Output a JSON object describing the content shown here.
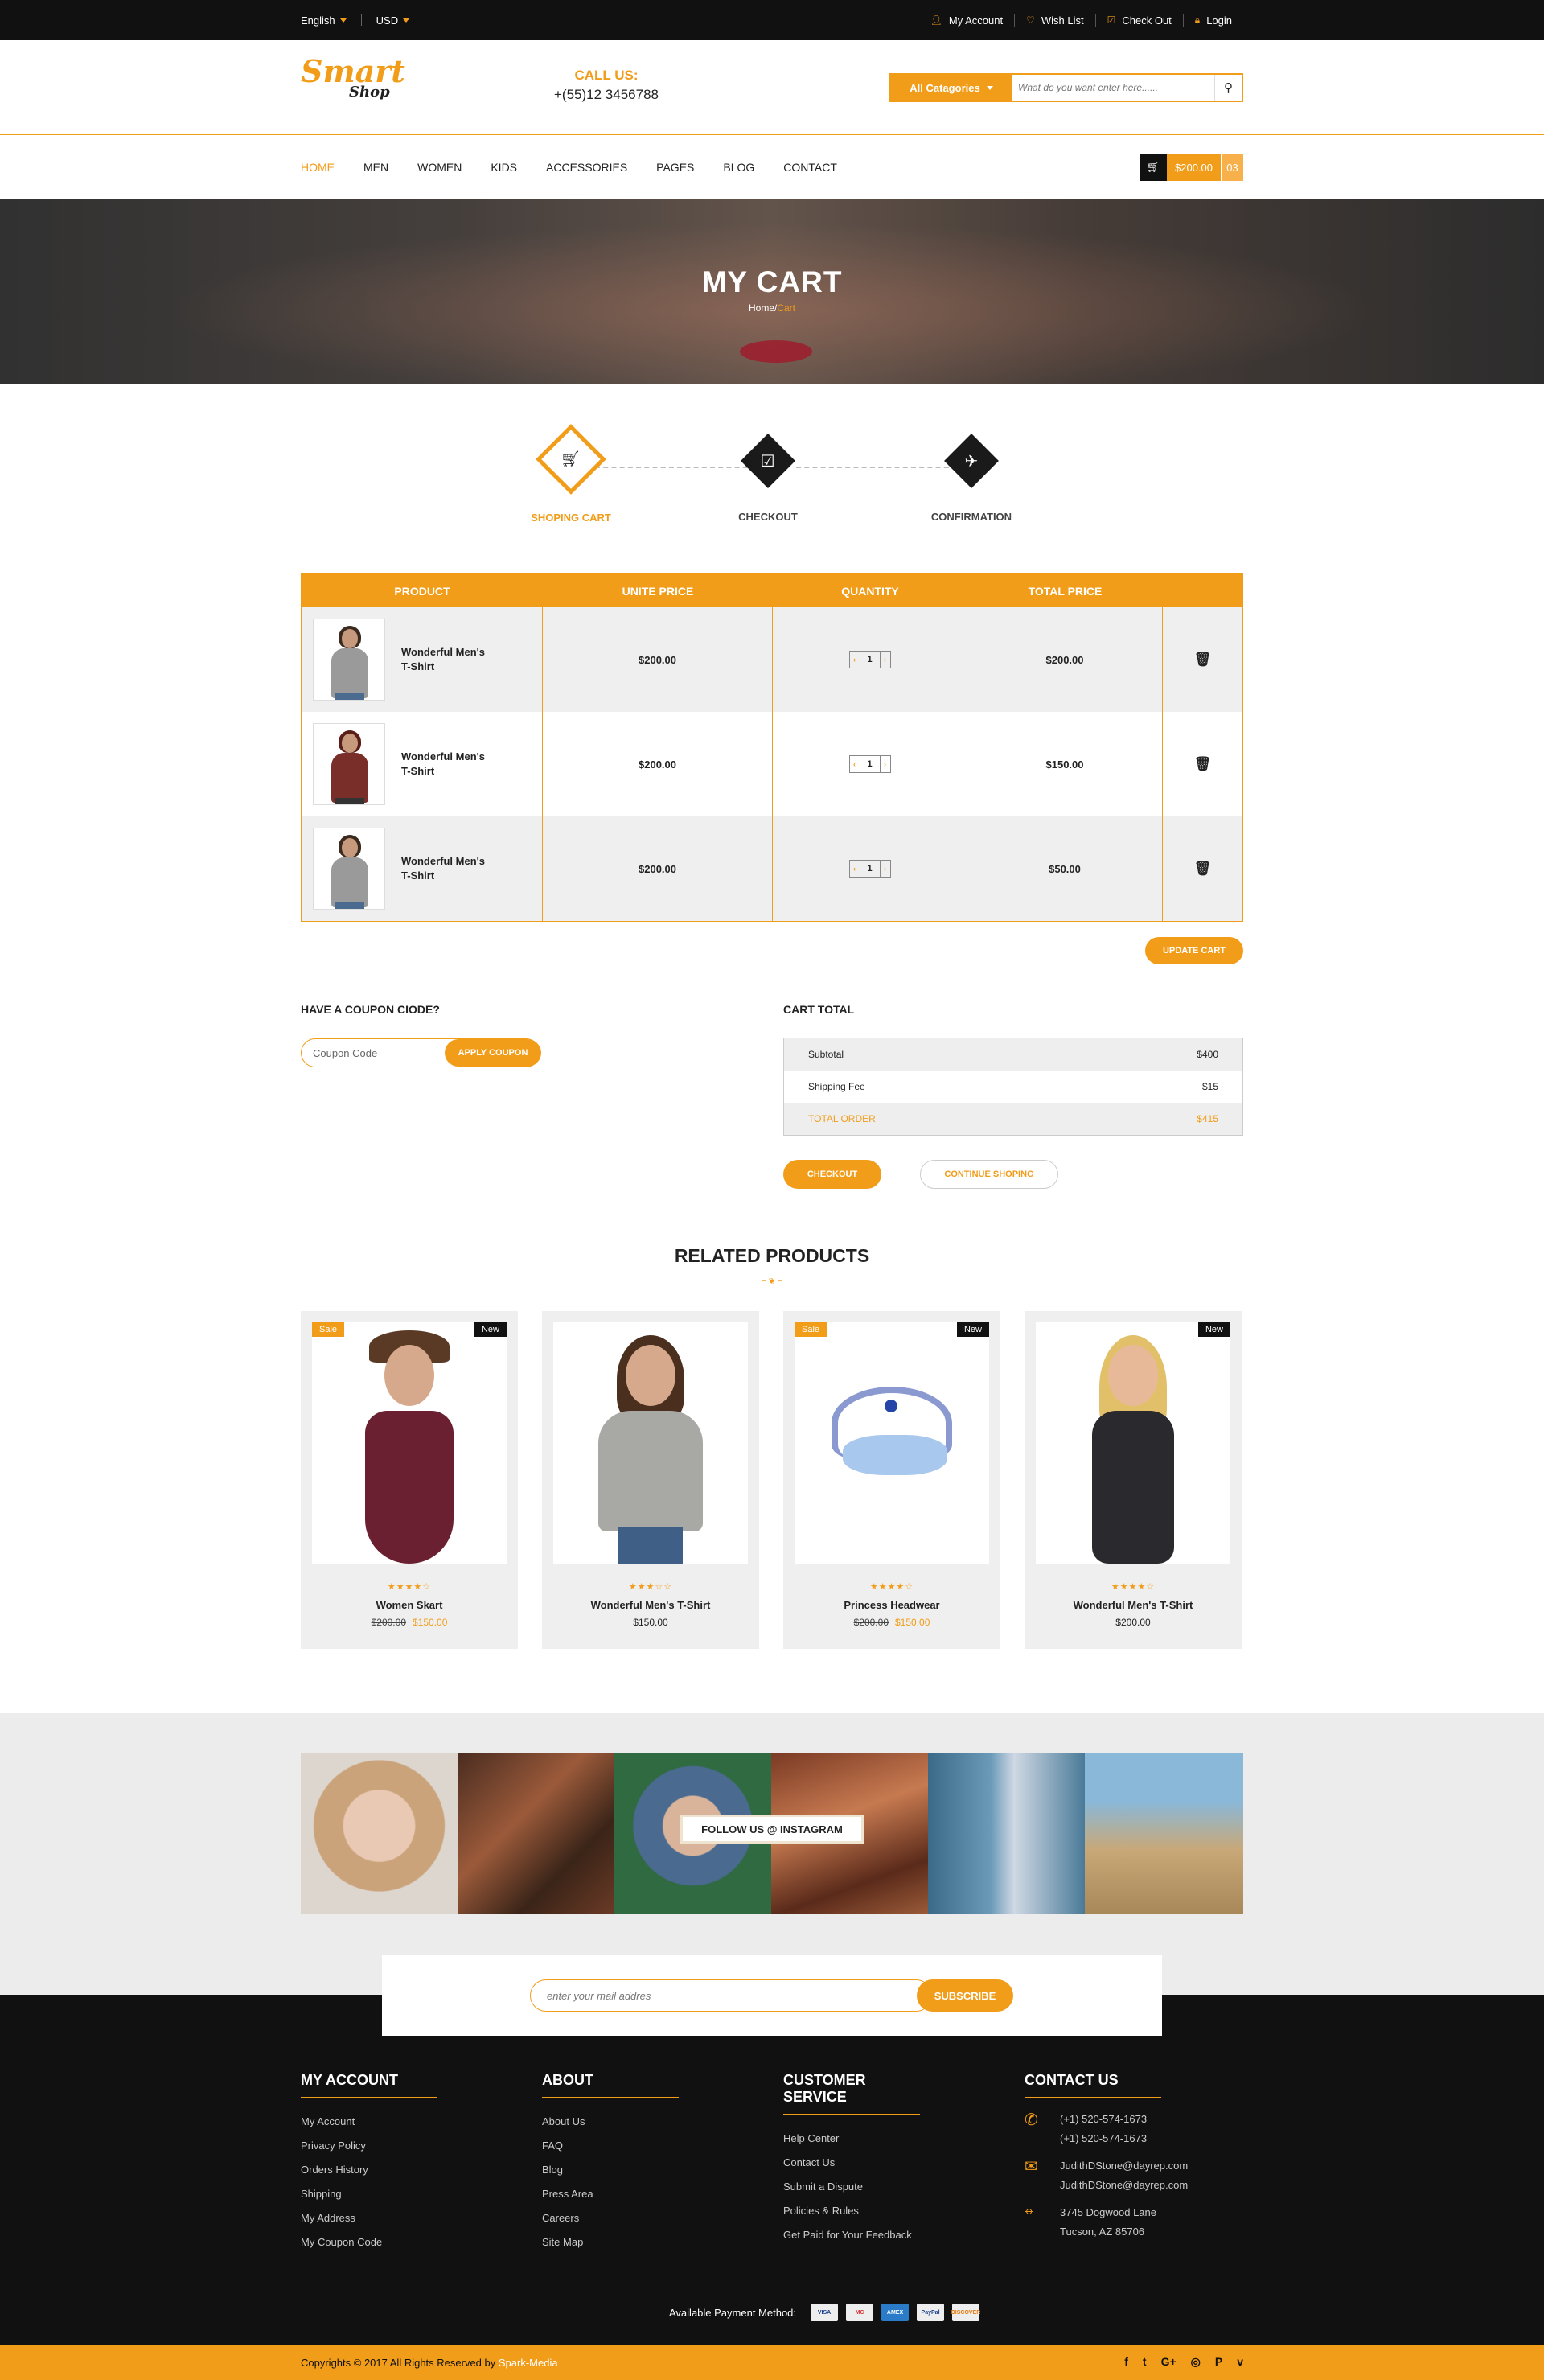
{
  "topbar": {
    "language": "English",
    "currency": "USD",
    "links": [
      {
        "icon": "user-icon",
        "label": "My Account"
      },
      {
        "icon": "heart-icon",
        "label": "Wish List"
      },
      {
        "icon": "checkbox-icon",
        "label": "Check Out"
      },
      {
        "icon": "lock-icon",
        "label": "Login"
      }
    ]
  },
  "header": {
    "logo_main": "Smart",
    "logo_sub": "Shop",
    "call_label": "CALL US:",
    "phone": "+(55)12 3456788",
    "search": {
      "category": "All Catagories",
      "placeholder": "What do you want enter here......"
    }
  },
  "nav": {
    "items": [
      "HOME",
      "MEN",
      "WOMEN",
      "KIDS",
      "ACCESSORIES",
      "PAGES",
      "BLOG",
      "CONTACT"
    ],
    "active": "HOME",
    "cart_total": "$200.00",
    "cart_count": "03"
  },
  "banner": {
    "title": "MY CART",
    "crumb_home": "Home/",
    "crumb_current": "Cart"
  },
  "steps": [
    {
      "label": "SHOPING CART",
      "icon": "cart-icon",
      "active": true
    },
    {
      "label": "CHECKOUT",
      "icon": "check-square-icon",
      "active": false
    },
    {
      "label": "CONFIRMATION",
      "icon": "paper-plane-icon",
      "active": false
    }
  ],
  "cart": {
    "headers": [
      "PRODUCT",
      "UNITE PRICE",
      "QUANTITY",
      "TOTAL PRICE"
    ],
    "rows": [
      {
        "name_line1": "Wonderful Men's",
        "name_line2": "T-Shirt",
        "unit_price": "$200.00",
        "qty": "1",
        "total": "$200.00"
      },
      {
        "name_line1": "Wonderful Men's",
        "name_line2": "T-Shirt",
        "unit_price": "$200.00",
        "qty": "1",
        "total": "$150.00"
      },
      {
        "name_line1": "Wonderful Men's",
        "name_line2": "T-Shirt",
        "unit_price": "$200.00",
        "qty": "1",
        "total": "$50.00"
      }
    ],
    "update_label": "UPDATE CART"
  },
  "coupon": {
    "title": "HAVE A COUPON CIODE?",
    "placeholder": "Coupon Code",
    "apply_label": "APPLY COUPON"
  },
  "totals": {
    "title": "CART TOTAL",
    "rows": [
      {
        "label": "Subtotal",
        "value": "$400"
      },
      {
        "label": "Shipping Fee",
        "value": "$15"
      },
      {
        "label": "TOTAL ORDER",
        "value": "$415"
      }
    ],
    "checkout_label": "CHECKOUT",
    "continue_label": "CONTINUE SHOPING"
  },
  "related": {
    "title": "RELATED PRODUCTS",
    "products": [
      {
        "name": "Women Skart",
        "old_price": "$200.00",
        "price": "$150.00",
        "sale": "Sale",
        "new": "New",
        "rating": 4
      },
      {
        "name": "Wonderful Men's T-Shirt",
        "old_price": "",
        "price": "$150.00",
        "sale": "",
        "new": "",
        "rating": 3
      },
      {
        "name": "Princess Headwear",
        "old_price": "$200.00",
        "price": "$150.00",
        "sale": "Sale",
        "new": "New",
        "rating": 4
      },
      {
        "name": "Wonderful Men's T-Shirt",
        "old_price": "",
        "price": "$200.00",
        "sale": "",
        "new": "New",
        "rating": 4
      }
    ]
  },
  "instagram": {
    "follow_label": "FOLLOW US @ INSTAGRAM"
  },
  "newsletter": {
    "placeholder": "enter your mail addres",
    "button": "SUBSCRIBE"
  },
  "footer": {
    "my_account": {
      "title": "MY ACCOUNT",
      "links": [
        "My Account",
        "Privacy Policy",
        "Orders History",
        "Shipping",
        "My Address",
        "My Coupon Code"
      ]
    },
    "about": {
      "title": "ABOUT",
      "links": [
        "About Us",
        "FAQ",
        "Blog",
        "Press Area",
        "Careers",
        "Site Map"
      ]
    },
    "customer_service": {
      "title": "CUSTOMER SERVICE",
      "links": [
        "Help Center",
        "Contact Us",
        "Submit a Dispute",
        "Policies & Rules",
        "Get Paid for Your Feedback"
      ]
    },
    "contact": {
      "title": "CONTACT US",
      "phone1": "(+1) 520-574-1673",
      "phone2": "(+1) 520-574-1673",
      "email1": "JudithDStone@dayrep.com",
      "email2": "JudithDStone@dayrep.com",
      "address1": "3745 Dogwood Lane",
      "address2": "Tucson, AZ 85706"
    },
    "payment_label": "Available Payment Method:",
    "payment_cards": [
      "VISA",
      "MC",
      "AMEX",
      "PayPal",
      "DISCOVER"
    ],
    "copyright": "Copyrights © 2017 All Rights Reserved by",
    "copyright_brand": "Spark-Media",
    "social": [
      "f",
      "t",
      "G+",
      "◎",
      "P",
      "v"
    ]
  },
  "colors": {
    "accent": "#f29d19",
    "dark": "#111111"
  }
}
